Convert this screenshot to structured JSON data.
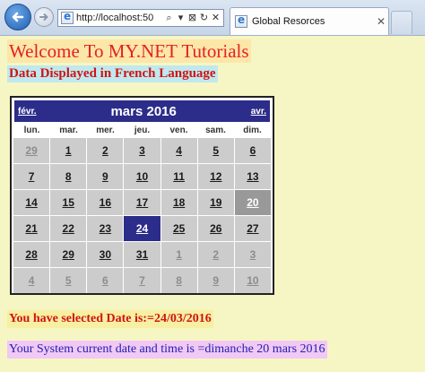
{
  "browser": {
    "url": "http://localhost:50",
    "tab_title": "Global Resorces",
    "tab_close": "✕",
    "address_icons": [
      "⌕",
      "▾",
      "⊠",
      "↻",
      "✕"
    ]
  },
  "page": {
    "welcome": "Welcome To MY.NET Tutorials",
    "subtitle": "Data Displayed in French Language",
    "selected_message": "You have selected Date is:=24/03/2016",
    "system_message": "Your System current date and time is =dimanche 20 mars 2016"
  },
  "calendar": {
    "prev_label": "févr.",
    "title": "mars 2016",
    "next_label": "avr.",
    "weekdays": [
      "lun.",
      "mar.",
      "mer.",
      "jeu.",
      "ven.",
      "sam.",
      "dim."
    ],
    "weeks": [
      [
        {
          "d": "29",
          "o": true
        },
        {
          "d": "1"
        },
        {
          "d": "2"
        },
        {
          "d": "3"
        },
        {
          "d": "4"
        },
        {
          "d": "5"
        },
        {
          "d": "6"
        }
      ],
      [
        {
          "d": "7"
        },
        {
          "d": "8"
        },
        {
          "d": "9"
        },
        {
          "d": "10"
        },
        {
          "d": "11"
        },
        {
          "d": "12"
        },
        {
          "d": "13"
        }
      ],
      [
        {
          "d": "14"
        },
        {
          "d": "15"
        },
        {
          "d": "16"
        },
        {
          "d": "17"
        },
        {
          "d": "18"
        },
        {
          "d": "19"
        },
        {
          "d": "20",
          "today": true
        }
      ],
      [
        {
          "d": "21"
        },
        {
          "d": "22"
        },
        {
          "d": "23"
        },
        {
          "d": "24",
          "selected": true
        },
        {
          "d": "25"
        },
        {
          "d": "26"
        },
        {
          "d": "27"
        }
      ],
      [
        {
          "d": "28"
        },
        {
          "d": "29"
        },
        {
          "d": "30"
        },
        {
          "d": "31"
        },
        {
          "d": "1",
          "o": true
        },
        {
          "d": "2",
          "o": true
        },
        {
          "d": "3",
          "o": true
        }
      ],
      [
        {
          "d": "4",
          "o": true
        },
        {
          "d": "5",
          "o": true
        },
        {
          "d": "6",
          "o": true
        },
        {
          "d": "7",
          "o": true
        },
        {
          "d": "8",
          "o": true
        },
        {
          "d": "9",
          "o": true
        },
        {
          "d": "10",
          "o": true
        }
      ]
    ]
  },
  "colors": {
    "calendar_header": "#2c2c8a",
    "selected_day": "#2c2c8a",
    "today_day": "#999999",
    "day_cell": "#cccccc",
    "page_background": "#f6f6c4"
  }
}
